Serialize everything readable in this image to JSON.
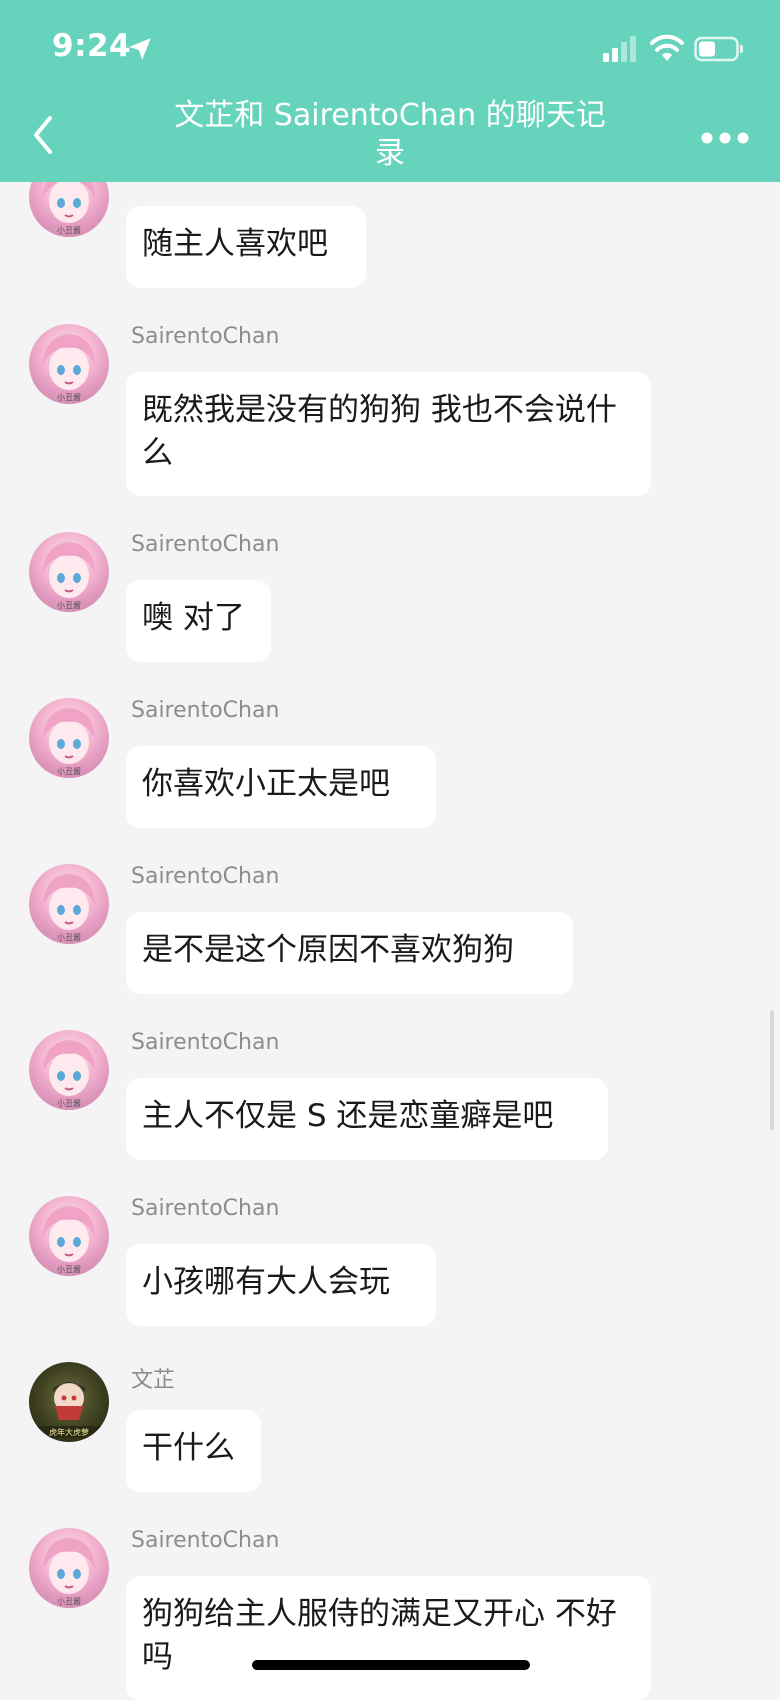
{
  "status_bar": {
    "time": "9:24"
  },
  "header": {
    "title": "文芷和 SairentoChan 的聊天记录"
  },
  "messages": [
    {
      "sender": "",
      "text": "随主人喜欢吧",
      "avatar": "pink"
    },
    {
      "sender": "SairentoChan",
      "text": "既然我是没有的狗狗 我也不会说什么",
      "avatar": "pink"
    },
    {
      "sender": "SairentoChan",
      "text": "噢 对了",
      "avatar": "pink"
    },
    {
      "sender": "SairentoChan",
      "text": "你喜欢小正太是吧",
      "avatar": "pink"
    },
    {
      "sender": "SairentoChan",
      "text": "是不是这个原因不喜欢狗狗",
      "avatar": "pink"
    },
    {
      "sender": "SairentoChan",
      "text": "主人不仅是 S 还是恋童癖是吧",
      "avatar": "pink"
    },
    {
      "sender": "SairentoChan",
      "text": "小孩哪有大人会玩",
      "avatar": "pink"
    },
    {
      "sender": "文芷",
      "text": "干什么",
      "avatar": "dark"
    },
    {
      "sender": "SairentoChan",
      "text": "狗狗给主人服侍的满足又开心 不好吗",
      "avatar": "pink"
    }
  ],
  "avatar_badges": {
    "pink": "小丑酱",
    "dark": "虎年大虎萝"
  },
  "colors": {
    "header": "#66d4bc",
    "background": "#f4f4f4",
    "bubble": "#ffffff"
  }
}
